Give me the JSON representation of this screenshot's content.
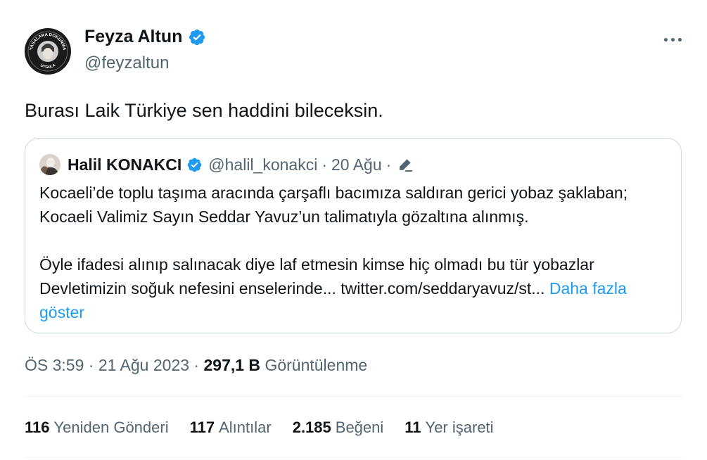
{
  "author": {
    "display_name": "Feyza Altun",
    "handle": "@feyzaltun",
    "avatar_text_top": "YASALARA DOKUNMA",
    "avatar_text_bottom": "UYGULA"
  },
  "tweet": {
    "text": "Burası Laik Türkiye sen haddini bileceksin."
  },
  "quoted": {
    "display_name": "Halil KONAKCI",
    "handle": "@halil_konakci",
    "separator": "·",
    "date": "20 Ağu",
    "paragraph_1": "Kocaeli’de toplu taşıma aracında çarşaflı bacımıza saldıran gerici yobaz şaklaban; Kocaeli Valimiz Sayın Seddar Yavuz’un talimatıyla gözaltına alınmış.",
    "paragraph_2": "Öyle ifadesi alınıp salınacak diye laf etmesin kimse hiç olmadı bu tür yobazlar Devletimizin soğuk nefesini enselerinde... twitter.com/seddaryavuz/st...",
    "show_more": "Daha fazla göster"
  },
  "meta": {
    "time": "ÖS 3:59",
    "separator": "·",
    "date": "21 Ağu 2023",
    "views_count": "297,1 B",
    "views_label": "Görüntülenme"
  },
  "stats": [
    {
      "count": "116",
      "label": "Yeniden Gönderi"
    },
    {
      "count": "117",
      "label": "Alıntılar"
    },
    {
      "count": "2.185",
      "label": "Beğeni"
    },
    {
      "count": "11",
      "label": "Yer işareti"
    }
  ],
  "icons": {
    "verified": "verified-badge-icon",
    "more": "more-horizontal-icon",
    "edit": "edit-pencil-icon"
  },
  "colors": {
    "accent": "#1d9bf0",
    "text": "#0f1419",
    "secondary": "#536471",
    "border": "#cfd9de"
  }
}
